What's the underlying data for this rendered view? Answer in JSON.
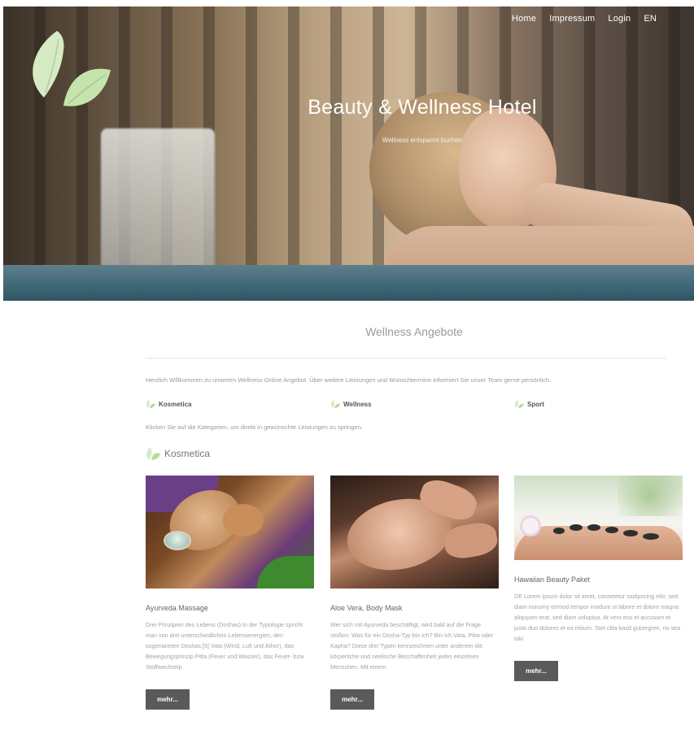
{
  "colors": {
    "leaf_light": "#d6ebc4",
    "leaf_mid": "#b9dc9b",
    "button_bg": "#5a5a5a",
    "text_muted": "#9a9a9a"
  },
  "nav": {
    "items": [
      "Home",
      "Impressum",
      "Login",
      "EN"
    ]
  },
  "hero": {
    "title": "Beauty & Wellness Hotel",
    "subtitle": "Wellness entspannt buchen"
  },
  "section": {
    "title": "Wellness Angebote",
    "intro": "Herzlich Willkommen zu unserem Wellness Online Angebot. Über weitere Leistungen und Wunschtermine informiert Sie unser Team gerne persönlich.",
    "categories": [
      "Kosmetica",
      "Wellness",
      "Sport"
    ],
    "hint": "Klicken Sie auf die Kategorien, um direkt in gewünschte Leistungen zu springen.",
    "subsection_title": "Kosmetica"
  },
  "cards": [
    {
      "title": "Ayurveda Massage",
      "text": "Drei Prinzipien des Lebens (Doshas) In der Typologie spricht man von drei unterschiedlichen Lebensenergien, den sogenannten Doshas.[5] Vata (Wind, Luft und Äther), das Bewegungsprinzip Pitta (Feuer und Wasser), das Feuer- bzw. Stoffwechselp",
      "button": "mehr..."
    },
    {
      "title": "Aloe Vera, Body Mask",
      "text": "Wer sich mit Ayurveda beschäftigt, wird bald auf die Frage stoßen: Was für ein Dosha-Typ bin ich? Bin ich Vata, Pitta oder Kapha? Diese drei Typen kennzeichnen unter anderem die körperliche und seelische Beschaffenheit jedes einzelnen Menschen. Mit einem",
      "button": "mehr..."
    },
    {
      "title": "Hawaiian Beauty Paket",
      "text": "DE Lorem ipsum dolor sit amet, consetetur sadipscing elitr, sed diam nonumy eirmod tempor invidunt ut labore et dolore magna aliquyam erat, sed diam voluptua. At vero eos et accusam et justo duo dolores et ea rebum. Stet clita kasd gubergren, no sea taki",
      "button": "mehr..."
    }
  ]
}
